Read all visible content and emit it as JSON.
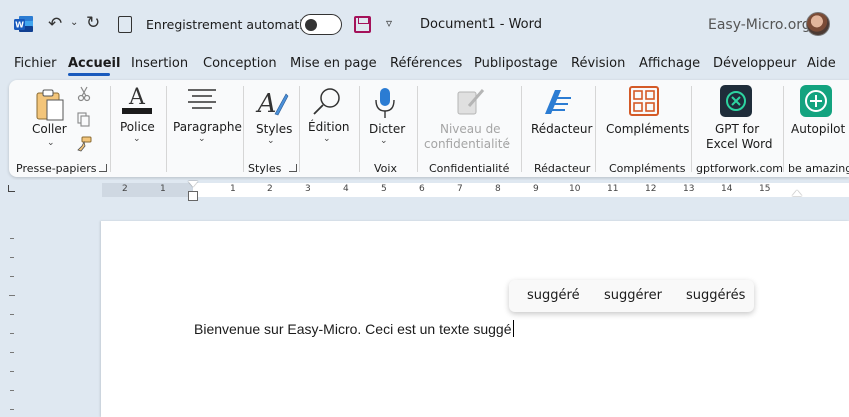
{
  "titlebar": {
    "autosave_label": "Enregistrement automatique",
    "doc_title": "Document1  -  Word",
    "brand": "Easy-Micro.org",
    "autosave_state": "off"
  },
  "tabs": [
    "Fichier",
    "Accueil",
    "Insertion",
    "Conception",
    "Mise en page",
    "Références",
    "Publipostage",
    "Révision",
    "Affichage",
    "Développeur",
    "Aide"
  ],
  "active_tab": "Accueil",
  "ribbon": {
    "coller": "Coller",
    "presse_papiers": "Presse-papiers",
    "police": "Police",
    "paragraphe": "Paragraphe",
    "styles": "Styles",
    "styles_group": "Styles",
    "edition": "Édition",
    "dicter": "Dicter",
    "voix": "Voix",
    "niveau_line1": "Niveau de",
    "niveau_line2": "confidentialité",
    "confidentialite": "Confidentialité",
    "redacteur": "Rédacteur",
    "redacteur_group": "Rédacteur",
    "complements": "Compléments",
    "complements_group": "Compléments",
    "gpt_line1": "GPT for",
    "gpt_line2": "Excel Word",
    "gptforwork": "gptforwork.com",
    "autopilot": "Autopilot",
    "be_amazing": "be amazing"
  },
  "ruler_numbers": [
    "2",
    "1",
    "1",
    "2",
    "3",
    "4",
    "5",
    "6",
    "7",
    "8",
    "9",
    "10",
    "11",
    "12",
    "13",
    "14",
    "15"
  ],
  "document": {
    "text": "Bienvenue sur Easy-Micro. Ceci est un texte suggé"
  },
  "suggestions": [
    "suggéré",
    "suggérer",
    "suggérés"
  ],
  "colors": {
    "accent": "#185abd",
    "save_icon": "#a4125a",
    "ribbon_bg": "#f9fafb",
    "window_bg": "#dfe8f1"
  }
}
